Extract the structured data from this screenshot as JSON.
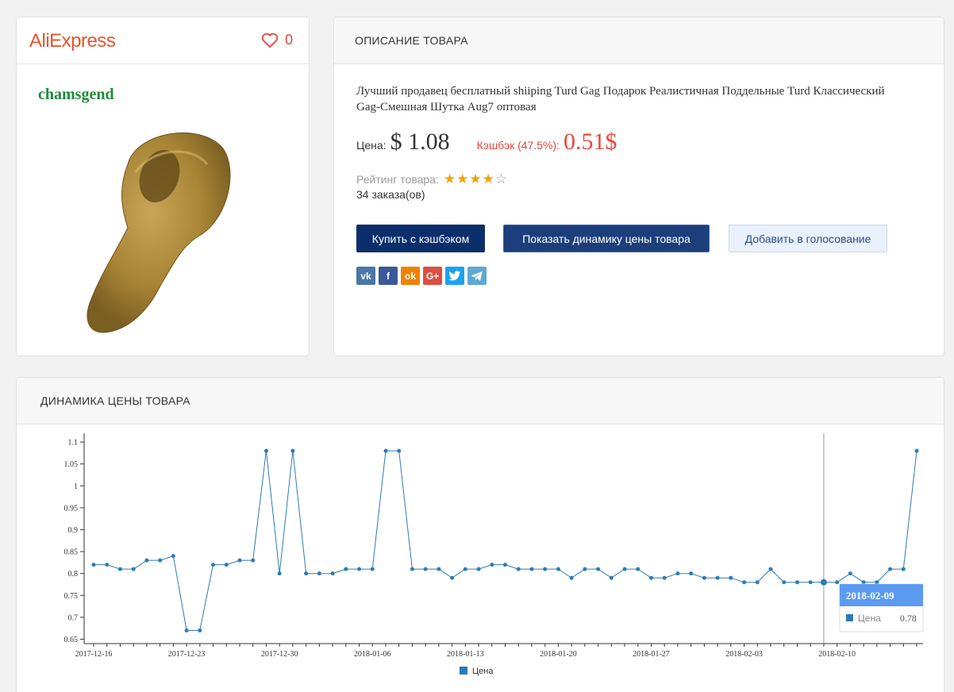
{
  "store": {
    "logo": "AliExpress",
    "favorites_count": "0"
  },
  "product": {
    "brand": "chamsgend"
  },
  "description": {
    "section_title": "ОПИСАНИЕ ТОВАРА",
    "text": "Лучший продавец бесплатный shiiping Turd Gag Подарок Реалистичная Поддельные Turd Классический Gag-Смешная Шутка Aug7 оптовая",
    "price_label": "Цена:",
    "price_value": "$ 1.08",
    "cashback_label": "Кэшбэк (47.5%):",
    "cashback_value": "0.51$",
    "rating_label": "Рейтинг товара:",
    "rating_stars": 4,
    "rating_max": 5,
    "orders": "34 заказа(ов)",
    "buttons": {
      "buy": "Купить с кэшбэком",
      "dynamics": "Показать динамику цены товара",
      "vote": "Добавить в голосование"
    },
    "social": [
      {
        "name": "vk-icon",
        "glyph": "vk",
        "color": "#4a76a8"
      },
      {
        "name": "facebook-icon",
        "glyph": "f",
        "color": "#3b5998"
      },
      {
        "name": "odnoklassniki-icon",
        "glyph": "ok",
        "color": "#ee8208"
      },
      {
        "name": "google-plus-icon",
        "glyph": "G+",
        "color": "#dc4e41"
      },
      {
        "name": "twitter-icon",
        "glyph": "t",
        "color": "#1da1f2"
      },
      {
        "name": "telegram-icon",
        "glyph": "tg",
        "color": "#5fa8d3"
      }
    ]
  },
  "chart_section": {
    "title": "ДИНАМИКА ЦЕНЫ ТОВАРА"
  },
  "chart_data": {
    "type": "line",
    "series": [
      {
        "name": "Цена",
        "color": "#2c7bb6",
        "values": [
          0.82,
          0.82,
          0.81,
          0.81,
          0.83,
          0.83,
          0.84,
          0.67,
          0.67,
          0.82,
          0.82,
          0.83,
          0.83,
          1.08,
          0.8,
          1.08,
          0.8,
          0.8,
          0.8,
          0.81,
          0.81,
          0.81,
          1.08,
          1.08,
          0.81,
          0.81,
          0.81,
          0.79,
          0.81,
          0.81,
          0.82,
          0.82,
          0.81,
          0.81,
          0.81,
          0.81,
          0.79,
          0.81,
          0.81,
          0.79,
          0.81,
          0.81,
          0.79,
          0.79,
          0.8,
          0.8,
          0.79,
          0.79,
          0.79,
          0.78,
          0.78,
          0.81,
          0.78,
          0.78,
          0.78,
          0.78,
          0.78,
          0.8,
          0.78,
          0.78,
          0.81,
          0.81,
          1.08
        ]
      }
    ],
    "start_date": "2017-12-16",
    "x_tick_labels": [
      "2017-12-16",
      "2017-12-23",
      "2017-12-30",
      "2018-01-06",
      "2018-01-13",
      "2018-01-20",
      "2018-01-27",
      "2018-02-03",
      "2018-02-10"
    ],
    "y_ticks": [
      "0.65",
      "0.7",
      "0.75",
      "0.8",
      "0.85",
      "0.9",
      "0.95",
      "1",
      "1.05",
      "1.1"
    ],
    "ylim": [
      0.64,
      1.12
    ],
    "legend": "bottom",
    "tooltip": {
      "date": "2018-02-09",
      "series": "Цена",
      "value": "0.78"
    }
  }
}
